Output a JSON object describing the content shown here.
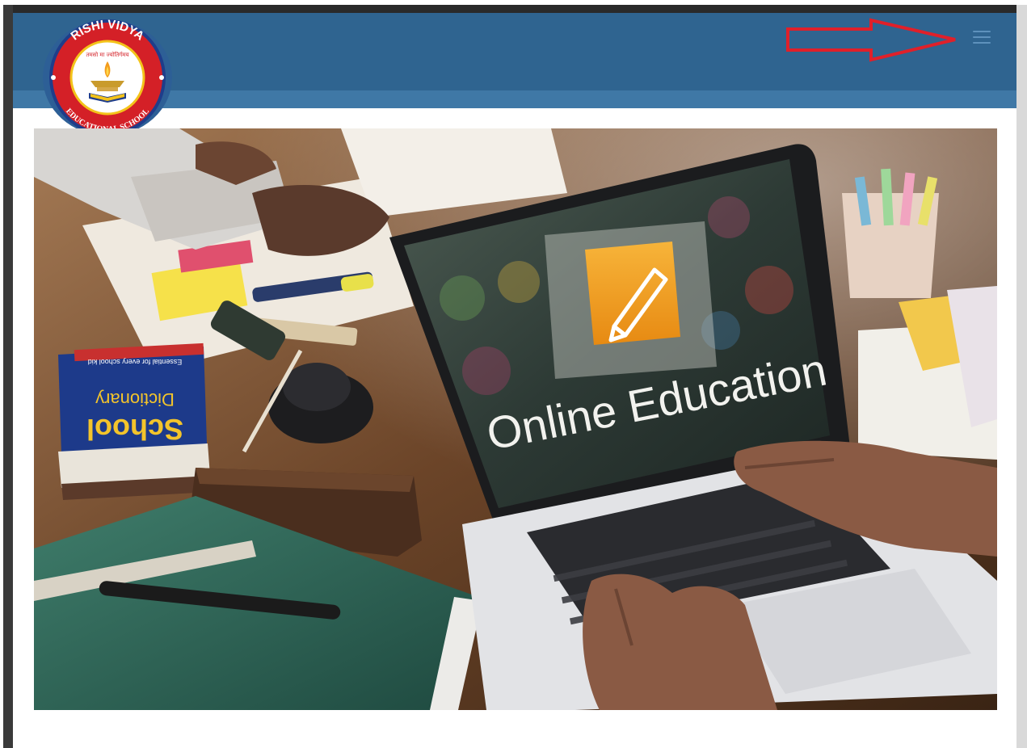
{
  "header": {
    "logo_top_text": "RISHI VIDYA",
    "logo_bottom_text": "EDUCATIONAL SCHOOL",
    "logo_motto": "तमसो मा ज्योतिर्गमय",
    "menu_button_label": "Menu"
  },
  "hero": {
    "screen_text": "Online Education",
    "book_title_line1": "School",
    "book_title_line2": "Dictionary",
    "book_tagline": "Essential for every school kid"
  },
  "annotation": {
    "arrow_color": "#e0202a"
  },
  "colors": {
    "navbar": "#2f6490",
    "subbar": "#3f78a6",
    "logo_ring": "#d42027",
    "logo_border": "#1f3d8a"
  }
}
